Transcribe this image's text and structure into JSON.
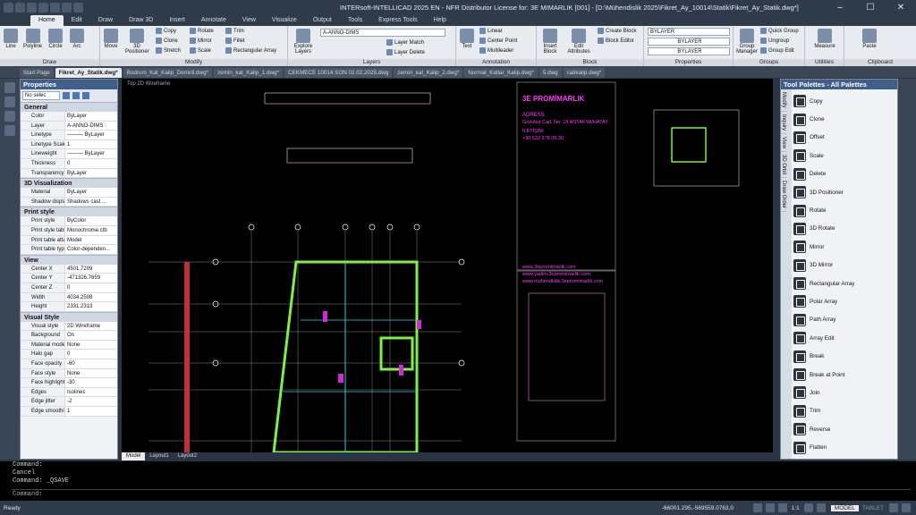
{
  "app": {
    "title": "INTERsoft-INTELLICAD 2025 EN - NFR Distributor License for: 3E MIMARLIK [001] - [D:\\Mühendislik 2025\\Fikret_Ay_10014\\Statik\\Fikret_Ay_Statik.dwg*]"
  },
  "menu_tabs": [
    "Home",
    "Edit",
    "Draw",
    "Draw 3D",
    "Insert",
    "Annotate",
    "View",
    "Visualize",
    "Output",
    "Tools",
    "Express Tools",
    "Help"
  ],
  "ribbon": {
    "draw": {
      "title": "Draw",
      "line": "Line",
      "polyline": "Polyline",
      "circle": "Circle",
      "arc": "Arc"
    },
    "modify": {
      "title": "Modify",
      "move": "Move",
      "positioner": "3D Positioner",
      "copy": "Copy",
      "clone": "Clone",
      "stretch": "Stretch",
      "rotate": "Rotate",
      "mirror": "Mirror",
      "scale": "Scale",
      "trim": "Trim",
      "fillet": "Fillet",
      "rect_array": "Rectangular Array"
    },
    "layers": {
      "title": "Layers",
      "explore": "Explore Layers",
      "current": "A-ANNO-DIMS",
      "match": "Layer Match",
      "delete": "Layer Delete"
    },
    "annotation": {
      "title": "Annotation",
      "text": "Text",
      "linear": "Linear",
      "center_point": "Center Point",
      "multileader": "Multileader"
    },
    "block": {
      "title": "Block",
      "insert": "Insert Block",
      "edit_attr": "Edit Attributes",
      "create": "Create Block",
      "editor": "Block Editor"
    },
    "properties": {
      "title": "Properties",
      "color": "BYLAYER",
      "linetype": "BYLAYER",
      "lineweight": "BYLAYER"
    },
    "groups": {
      "title": "Groups",
      "manager": "Group Manager",
      "quick": "Quick Group",
      "ungroup": "Ungroup",
      "edit": "Group Edit"
    },
    "utilities": {
      "title": "Utilities",
      "measure": "Measure"
    },
    "clipboard": {
      "title": "Clipboard",
      "paste": "Paste"
    }
  },
  "doc_tabs": [
    "Start Page",
    "Fikret_Ay_Statik.dwg*",
    "Bodrum_Kat_Kalip_Demirli.dwg*",
    "zemin_kat_Kalip_1.dwg*",
    "CEKMECE 10014 SON 02.02.2025.dwg",
    "zemin_kat_Kalip_2.dwg*",
    "Normal_Katlar_Kalip.dwg*",
    "5.dwg",
    "catikalip.dwg*"
  ],
  "properties_panel": {
    "title": "Properties",
    "selection": "No selec",
    "sections": [
      {
        "name": "General",
        "rows": [
          [
            "Color",
            "ByLayer"
          ],
          [
            "Layer",
            "A-ANNO-DIMS"
          ],
          [
            "Linetype",
            "——— ByLayer"
          ],
          [
            "Linetype Scale",
            "1"
          ],
          [
            "Lineweight",
            "——— ByLayer"
          ],
          [
            "Thickness",
            "0"
          ],
          [
            "Transparency",
            "ByLayer"
          ]
        ]
      },
      {
        "name": "3D Visualization",
        "rows": [
          [
            "Material",
            "ByLayer"
          ],
          [
            "Shadow display",
            "Shadows cast ..."
          ]
        ]
      },
      {
        "name": "Print style",
        "rows": [
          [
            "Print style",
            "ByColor"
          ],
          [
            "Print style table",
            "Monochrome.ctb"
          ],
          [
            "Print table attac...",
            "Model"
          ],
          [
            "Print table type",
            "Color-dependen..."
          ]
        ]
      },
      {
        "name": "View",
        "rows": [
          [
            "Center X",
            "4501.7209"
          ],
          [
            "Center Y",
            "-471326.7659"
          ],
          [
            "Center Z",
            "0"
          ],
          [
            "Width",
            "4034.2508"
          ],
          [
            "Height",
            "2331.2313"
          ]
        ]
      },
      {
        "name": "Visual Style",
        "rows": [
          [
            "Visual style",
            "2D Wireframe"
          ],
          [
            "Background",
            "On"
          ],
          [
            "Material mode",
            "None"
          ],
          [
            "Halo gap",
            "0"
          ],
          [
            "Face opacity",
            "-60"
          ],
          [
            "Face style",
            "None"
          ],
          [
            "Face highlight",
            "-30"
          ],
          [
            "Edges",
            "Isolines"
          ],
          [
            "Edge jitter",
            "-2"
          ],
          [
            "Edge smoothing",
            "1"
          ]
        ]
      }
    ]
  },
  "canvas": {
    "viewport_label": "Top  2D Wireframe",
    "company": "3E PROMİMARLIK",
    "address_label": "ADRESS:",
    "address": "Gözütez Cad. No: 18 ANTAKYA/HATAY",
    "contact_label": "İLETİŞİM:",
    "phone": "+90 532 378 05 30",
    "web1": "www.3epromimarlik.com",
    "web2": "www.yadim.3epromimarlik.com",
    "web3": "www.muhendislik.3epromimarlik.com"
  },
  "layout_tabs": [
    "Model",
    "Layout1",
    "Layout2"
  ],
  "tool_palette": {
    "title": "Tool Palettes - All Palettes",
    "side_tabs": [
      "Modify",
      "Inquiry",
      "View",
      "3D Orbit",
      "Draw Order"
    ],
    "tools": [
      "Copy",
      "Clone",
      "Offset",
      "Scale",
      "Delete",
      "3D Positioner",
      "Rotate",
      "3D Rotate",
      "Mirror",
      "3D Mirror",
      "Rectangular Array",
      "Polar Array",
      "Path Array",
      "Array Edit",
      "Break",
      "Break at Point",
      "Join",
      "Trim",
      "Reverse",
      "Flatten"
    ]
  },
  "command_line": [
    "Command:",
    "Cancel",
    "Command: _QSAVE"
  ],
  "command_prompt": "Command:",
  "status": {
    "ready": "Ready",
    "coords": "-66001.295,-569559.0763,0",
    "scale": "1:1",
    "mode": "MODEL",
    "tablet": "TABLET"
  }
}
